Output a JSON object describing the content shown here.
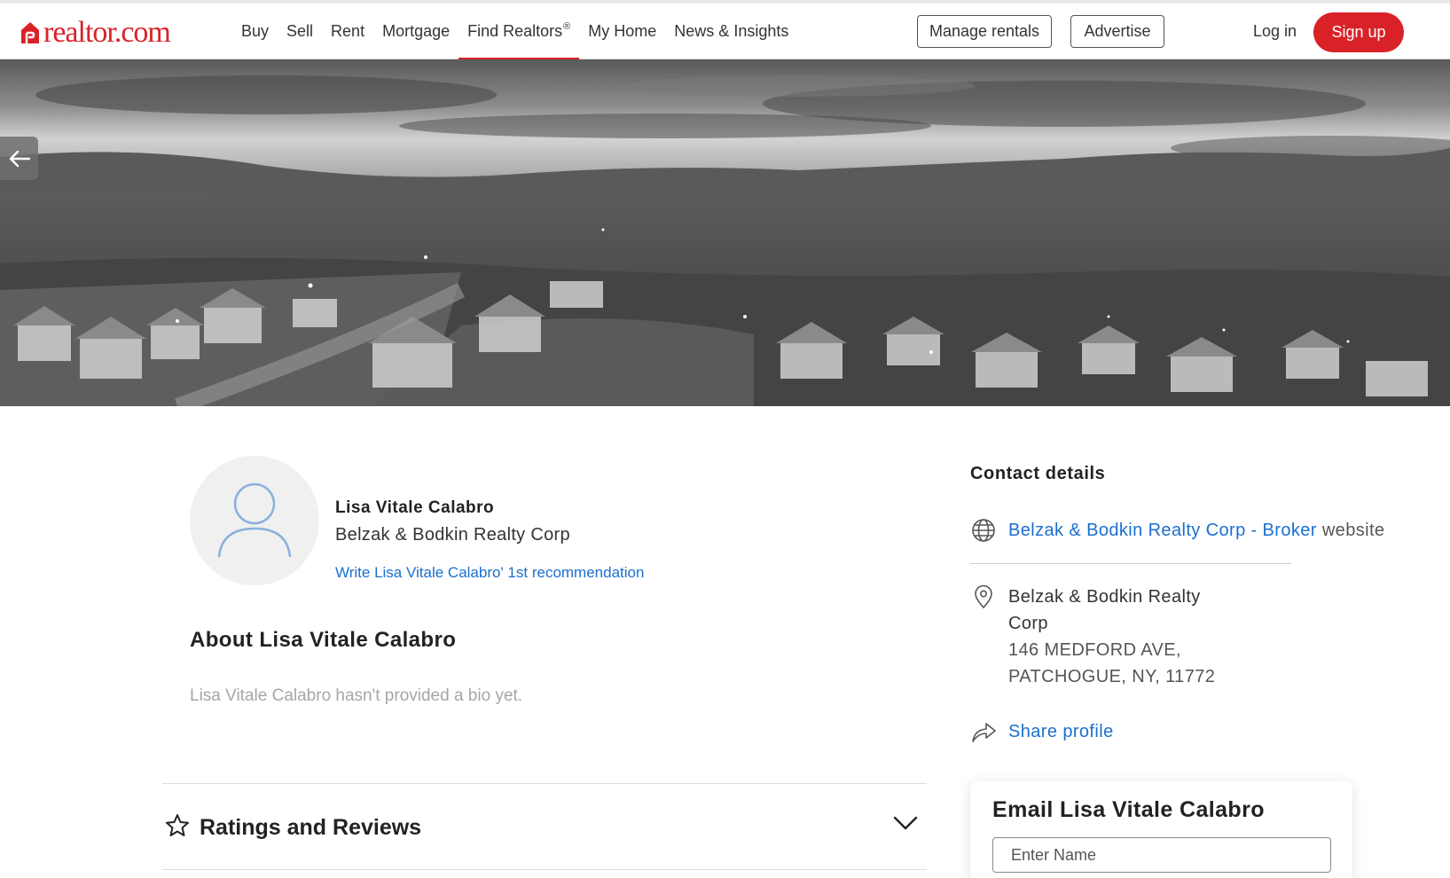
{
  "brand": {
    "logo_text": "realtor.com",
    "accent_color": "#d92228",
    "link_color": "#1a6fd0"
  },
  "nav": {
    "items": [
      {
        "label": "Buy"
      },
      {
        "label": "Sell"
      },
      {
        "label": "Rent"
      },
      {
        "label": "Mortgage"
      },
      {
        "label": "Find Realtors",
        "sup": "®",
        "active": true
      },
      {
        "label": "My Home"
      },
      {
        "label": "News & Insights"
      }
    ],
    "manage_rentals": "Manage rentals",
    "advertise": "Advertise",
    "login": "Log in",
    "signup": "Sign up"
  },
  "hero": {
    "back_icon": "arrow-left-icon"
  },
  "profile": {
    "avatar_icon": "user-placeholder-icon",
    "name": "Lisa Vitale Calabro",
    "company": "Belzak & Bodkin Realty Corp",
    "recommend_link": "Write Lisa Vitale Calabro' 1st recommendation",
    "about_prefix": "About ",
    "about_name": "Lisa Vitale Calabro",
    "bio": "Lisa Vitale Calabro hasn't provided a bio yet."
  },
  "ratings": {
    "label": "Ratings and Reviews",
    "star_icon": "star-outline-icon",
    "chevron_icon": "chevron-down-icon"
  },
  "contact": {
    "title": "Contact details",
    "website_icon": "globe-icon",
    "website_link": "Belzak & Bodkin Realty Corp - Broker",
    "website_suffix": " website",
    "location_icon": "map-pin-icon",
    "office_name": "Belzak & Bodkin Realty Corp",
    "address_line1": "146 MEDFORD AVE,",
    "address_line2": "PATCHOGUE, NY, 11772",
    "share_icon": "share-arrow-icon",
    "share_label": "Share profile"
  },
  "email_form": {
    "title": "Email Lisa Vitale Calabro",
    "name_placeholder": "Enter Name"
  }
}
